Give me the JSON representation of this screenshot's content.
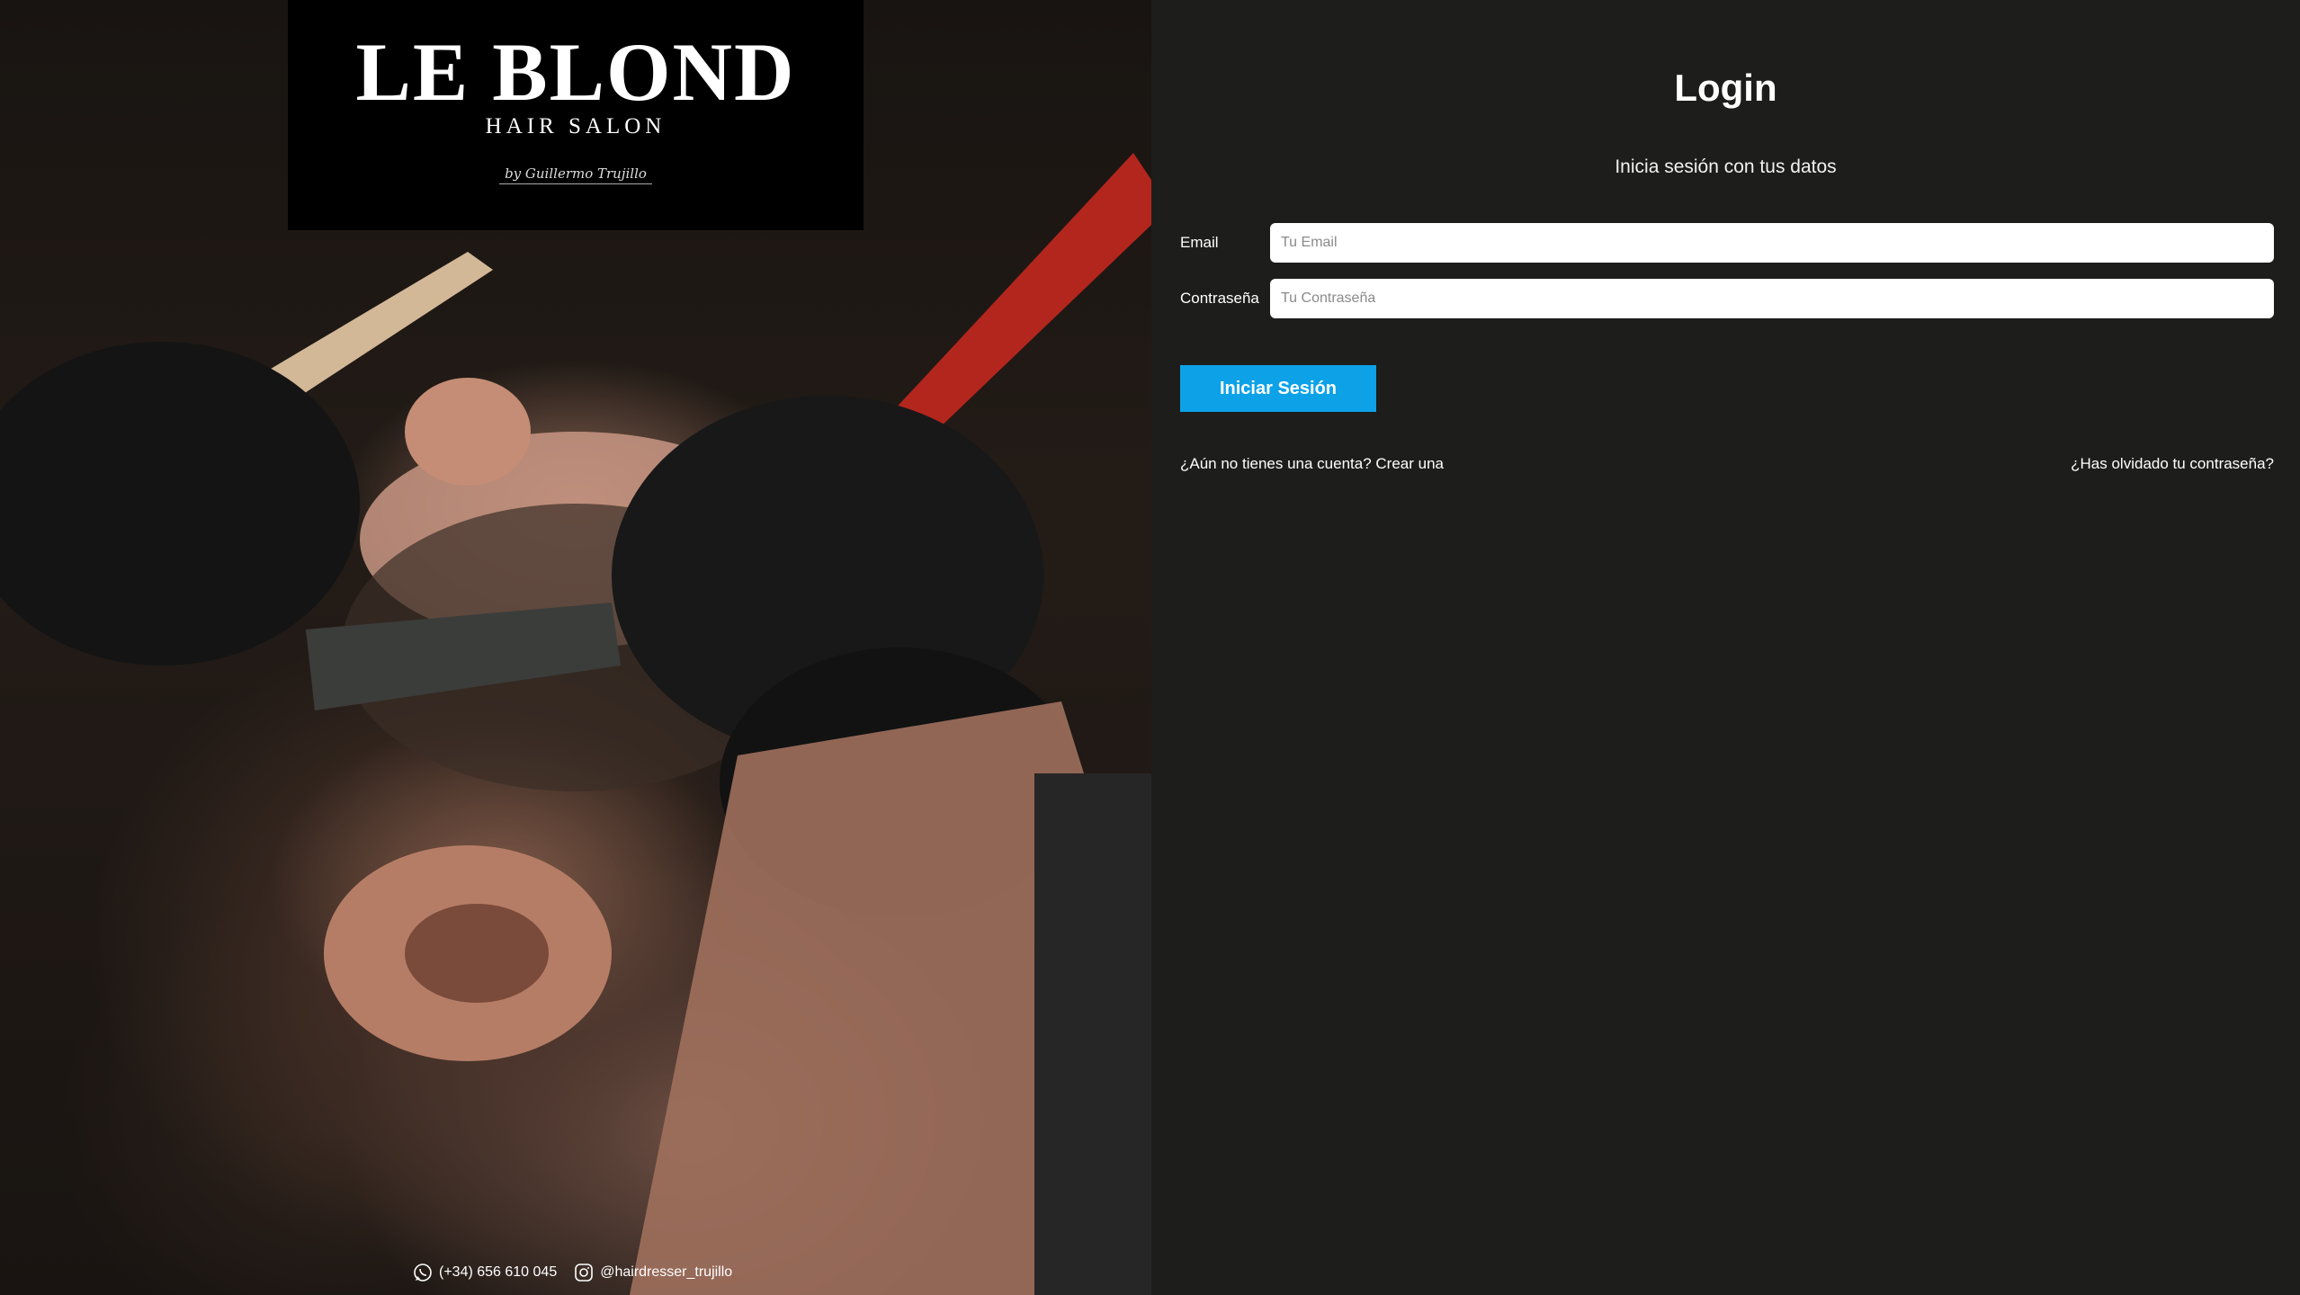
{
  "brand": {
    "name": "LE BLOND",
    "tagline": "HAIR SALON",
    "signature": "by Guillermo Trujillo"
  },
  "contact": {
    "phone": "(+34) 656 610 045",
    "instagram": "@hairdresser_trujillo"
  },
  "login": {
    "title": "Login",
    "subtitle": "Inicia sesión con tus datos",
    "email_label": "Email",
    "email_placeholder": "Tu Email",
    "email_value": "",
    "password_label": "Contraseña",
    "password_placeholder": "Tu Contraseña",
    "password_value": "",
    "submit_label": "Iniciar Sesión",
    "register_link": "¿Aún no tienes una cuenta? Crear una",
    "forgot_link": "¿Has olvidado tu contraseña?"
  },
  "icons": {
    "whatsapp": "whatsapp-icon",
    "instagram": "instagram-icon"
  },
  "colors": {
    "background": "#1d1d1b",
    "accent": "#0da2e7",
    "input_bg": "#ffffff",
    "logo_bg": "#000000"
  }
}
